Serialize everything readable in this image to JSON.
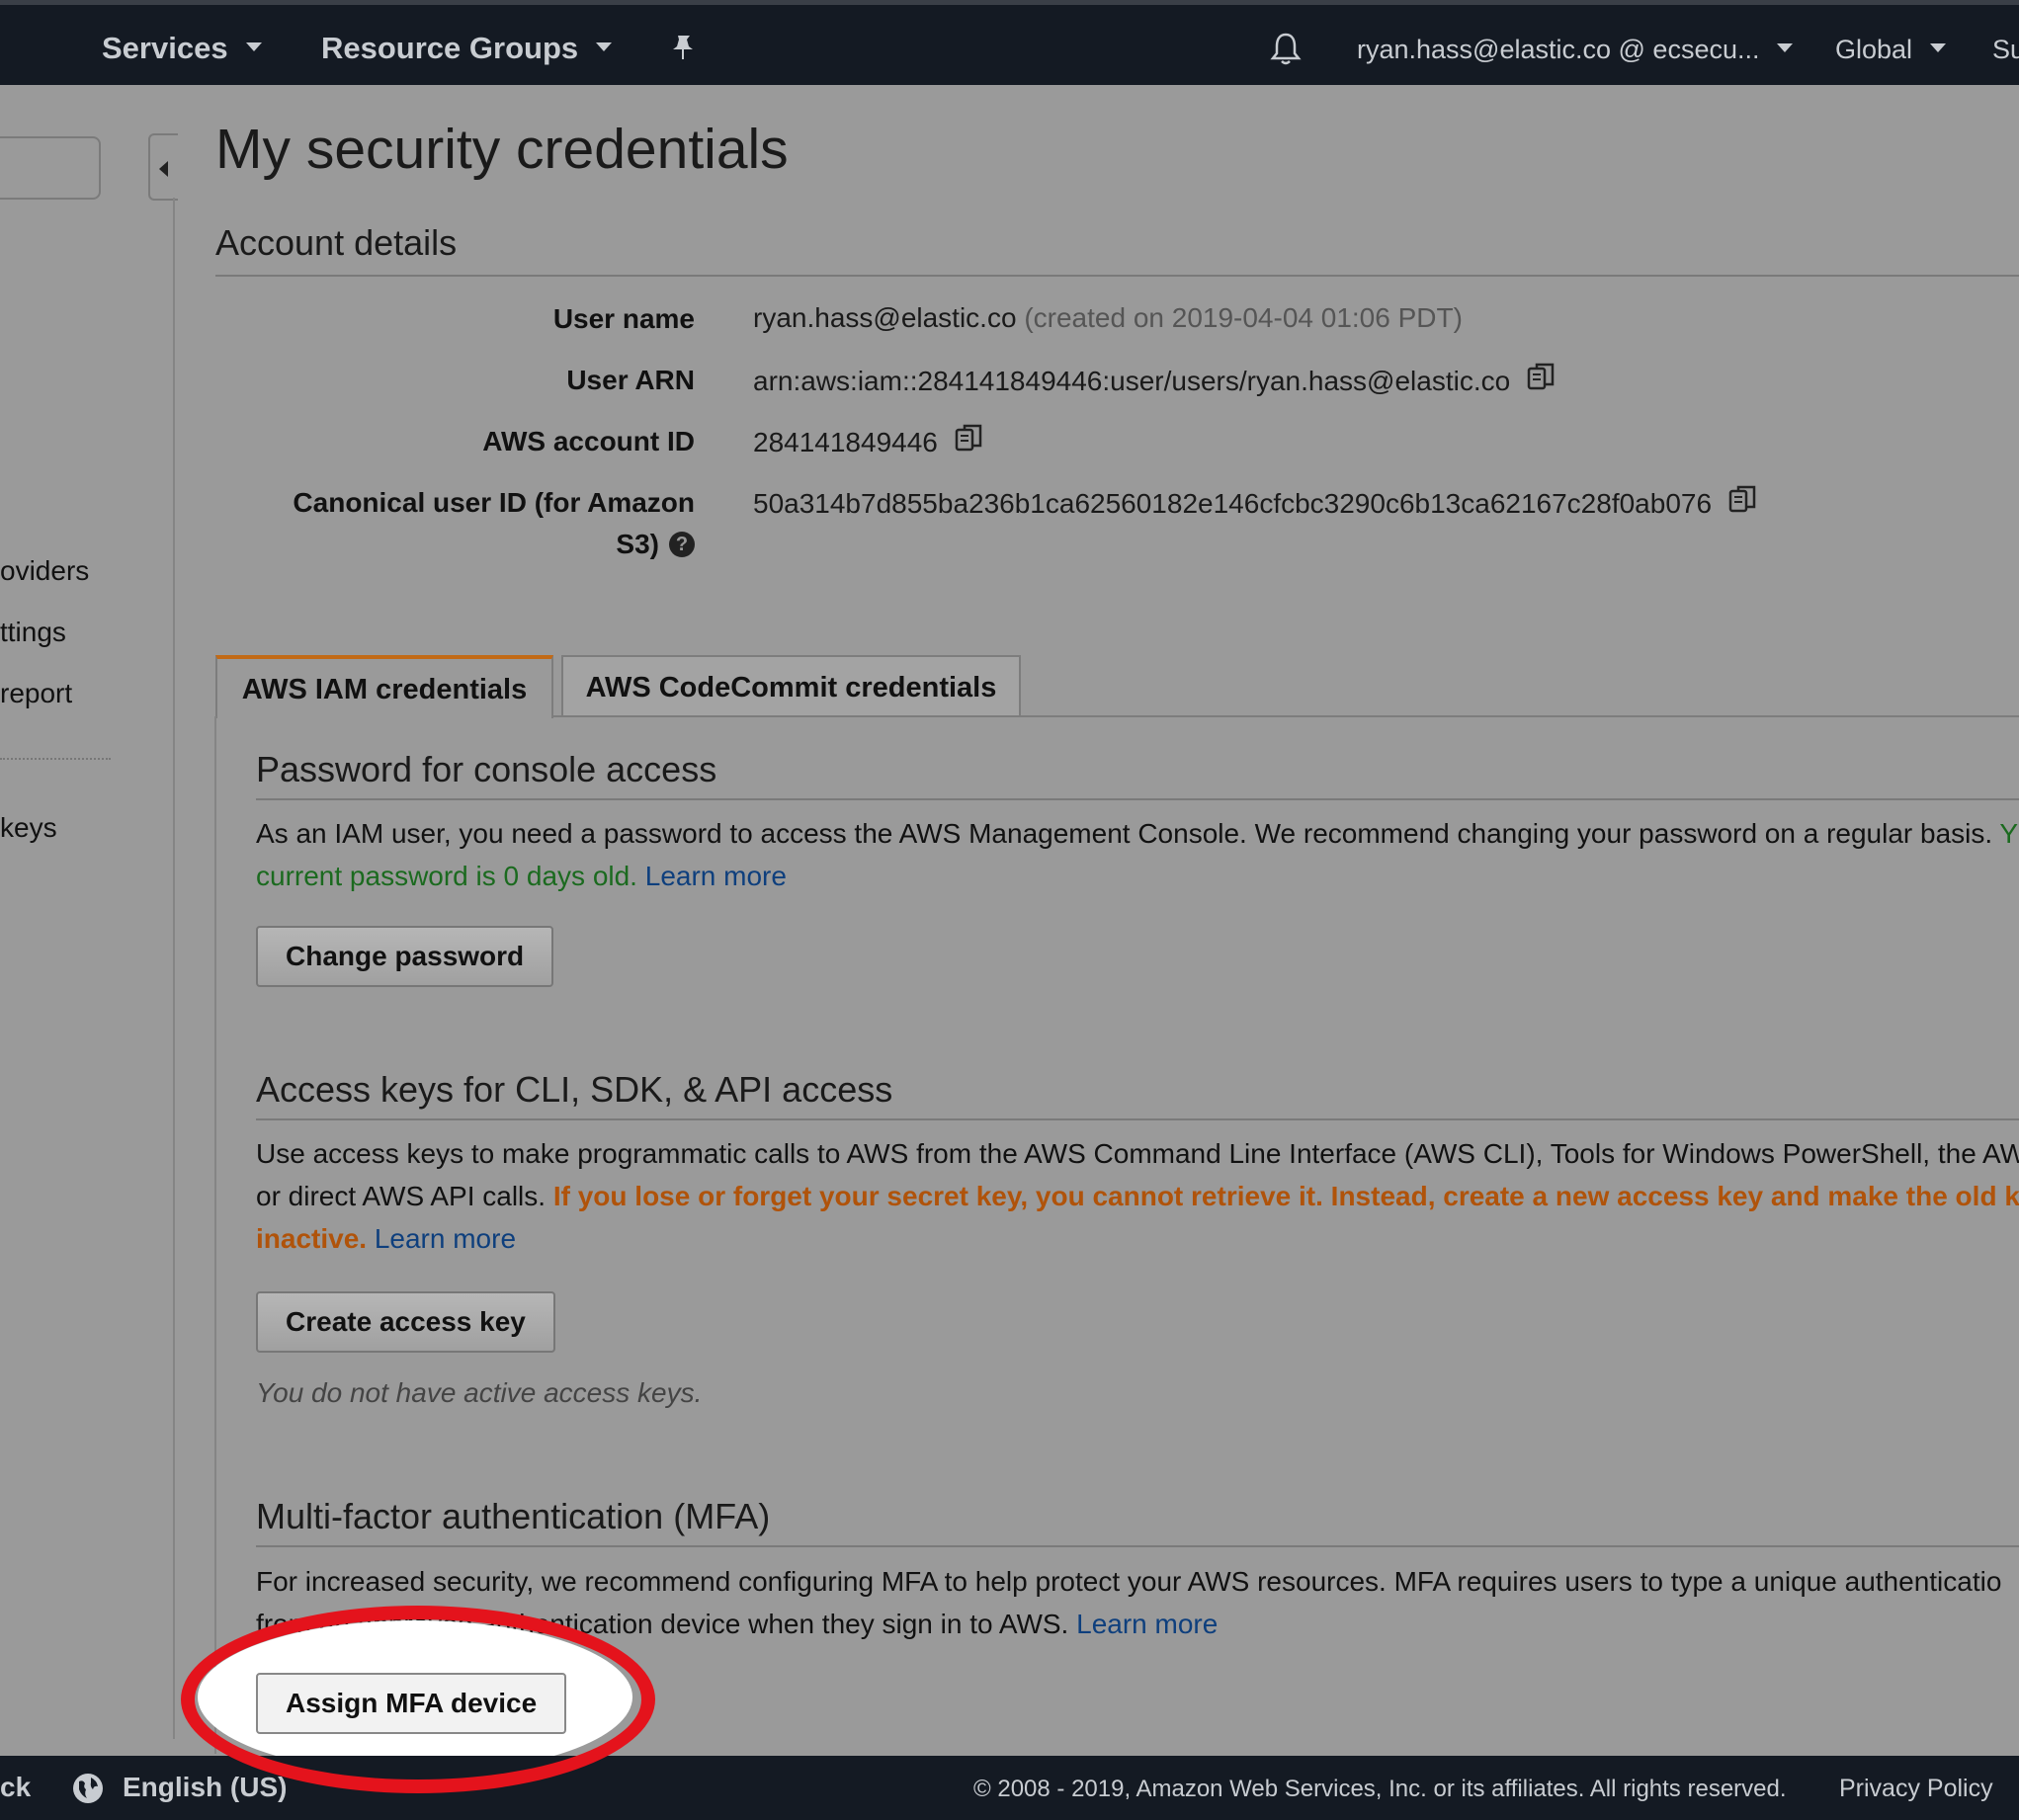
{
  "topnav": {
    "services": "Services",
    "resource_groups": "Resource Groups",
    "account": "ryan.hass@elastic.co @ ecsecu...",
    "region": "Global",
    "support_partial": "Su"
  },
  "sidebar": {
    "links": [
      "oviders",
      "ttings",
      "report",
      "keys"
    ]
  },
  "page": {
    "title": "My security credentials",
    "account_details_heading": "Account details"
  },
  "account_details": {
    "user_name_label": "User name",
    "user_name_value": "ryan.hass@elastic.co",
    "user_name_created": "(created on 2019-04-04 01:06 PDT)",
    "user_arn_label": "User ARN",
    "user_arn_value": "arn:aws:iam::284141849446:user/users/ryan.hass@elastic.co",
    "account_id_label": "AWS account ID",
    "account_id_value": "284141849446",
    "canonical_label_line1": "Canonical user ID (for Amazon",
    "canonical_label_line2": "S3)",
    "canonical_value": "50a314b7d855ba236b1ca62560182e146cfcbc3290c6b13ca62167c28f0ab076"
  },
  "tabs": {
    "iam": "AWS IAM credentials",
    "codecommit": "AWS CodeCommit credentials"
  },
  "password_section": {
    "heading": "Password for console access",
    "text_line1": "As an IAM user, you need a password to access the AWS Management Console. We recommend changing your password on a regular basis.",
    "text_line1_green": " Y",
    "text_line2_green": "current password is 0 days old.",
    "learn_more": "Learn more",
    "button": "Change password"
  },
  "access_keys_section": {
    "heading": "Access keys for CLI, SDK, & API access",
    "text_line1": "Use access keys to make programmatic calls to AWS from the AWS Command Line Interface (AWS CLI), Tools for Windows PowerShell, the AW",
    "text_line2_plain": "or direct AWS API calls.",
    "text_line2_warning": "If you lose or forget your secret key, you cannot retrieve it. Instead, create a new access key and make the old k",
    "text_line3_warning": "inactive.",
    "learn_more": "Learn more",
    "button": "Create access key",
    "no_keys_note": "You do not have active access keys."
  },
  "mfa_section": {
    "heading": "Multi-factor authentication (MFA)",
    "text_line1": "For increased security, we recommend configuring MFA to help protect your AWS resources. MFA requires users to type a unique authenticatio",
    "text_line2": "from an approved authentication device when they sign in to AWS.",
    "learn_more": "Learn more",
    "button": "Assign MFA device"
  },
  "footer": {
    "feedback_partial": "ck",
    "language": "English (US)",
    "copyright": "© 2008 - 2019, Amazon Web Services, Inc. or its affiliates. All rights reserved.",
    "privacy": "Privacy Policy"
  },
  "colors": {
    "topbar": "#141a23",
    "tab_accent": "#c26a16",
    "warning_text": "#b0530a",
    "green_text": "#1b6a1f",
    "link": "#0e3f7d",
    "highlight_ring": "#e4131c"
  },
  "icons": [
    "chevron-down-icon",
    "pin-icon",
    "bell-icon",
    "copy-icon",
    "help-icon",
    "globe-icon",
    "collapse-sidebar-icon"
  ]
}
